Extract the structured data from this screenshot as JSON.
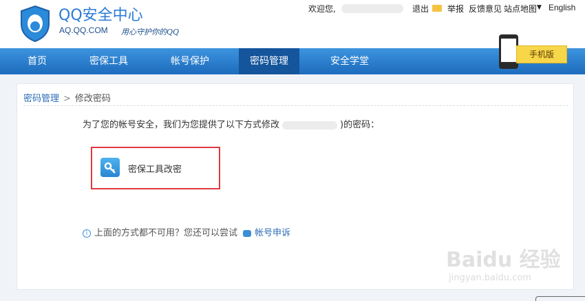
{
  "header": {
    "title": "QQ安全中心",
    "domain": "AQ.QQ.COM",
    "slogan": "用心守护你的QQ"
  },
  "toplinks": {
    "welcome": "欢迎您,",
    "logout": "退出",
    "report": "举报",
    "feedback": "反馈意见",
    "sitemap": "站点地图",
    "english": "English"
  },
  "nav": {
    "items": [
      {
        "label": "首页"
      },
      {
        "label": "密保工具"
      },
      {
        "label": "帐号保护"
      },
      {
        "label": "密码管理"
      },
      {
        "label": "安全学堂"
      }
    ],
    "active_index": 3,
    "mobile_label": "手机版"
  },
  "breadcrumb": {
    "parent": "密码管理",
    "separator": ">",
    "current": "修改密码"
  },
  "content": {
    "intro_before": "为了您的帐号安全，我们为您提供了以下方式修改",
    "intro_after": ")的密码：",
    "option_label": "密保工具改密",
    "help_text": "上面的方式都不可用？您还可以尝试",
    "appeal_link": "帐号申诉"
  },
  "watermark": {
    "brand": "Baidu 经验",
    "url": "jingyan.baidu.com"
  },
  "colors": {
    "accent_blue": "#2b7bd3",
    "nav_active": "#14559c",
    "highlight_red": "#e0393e"
  }
}
